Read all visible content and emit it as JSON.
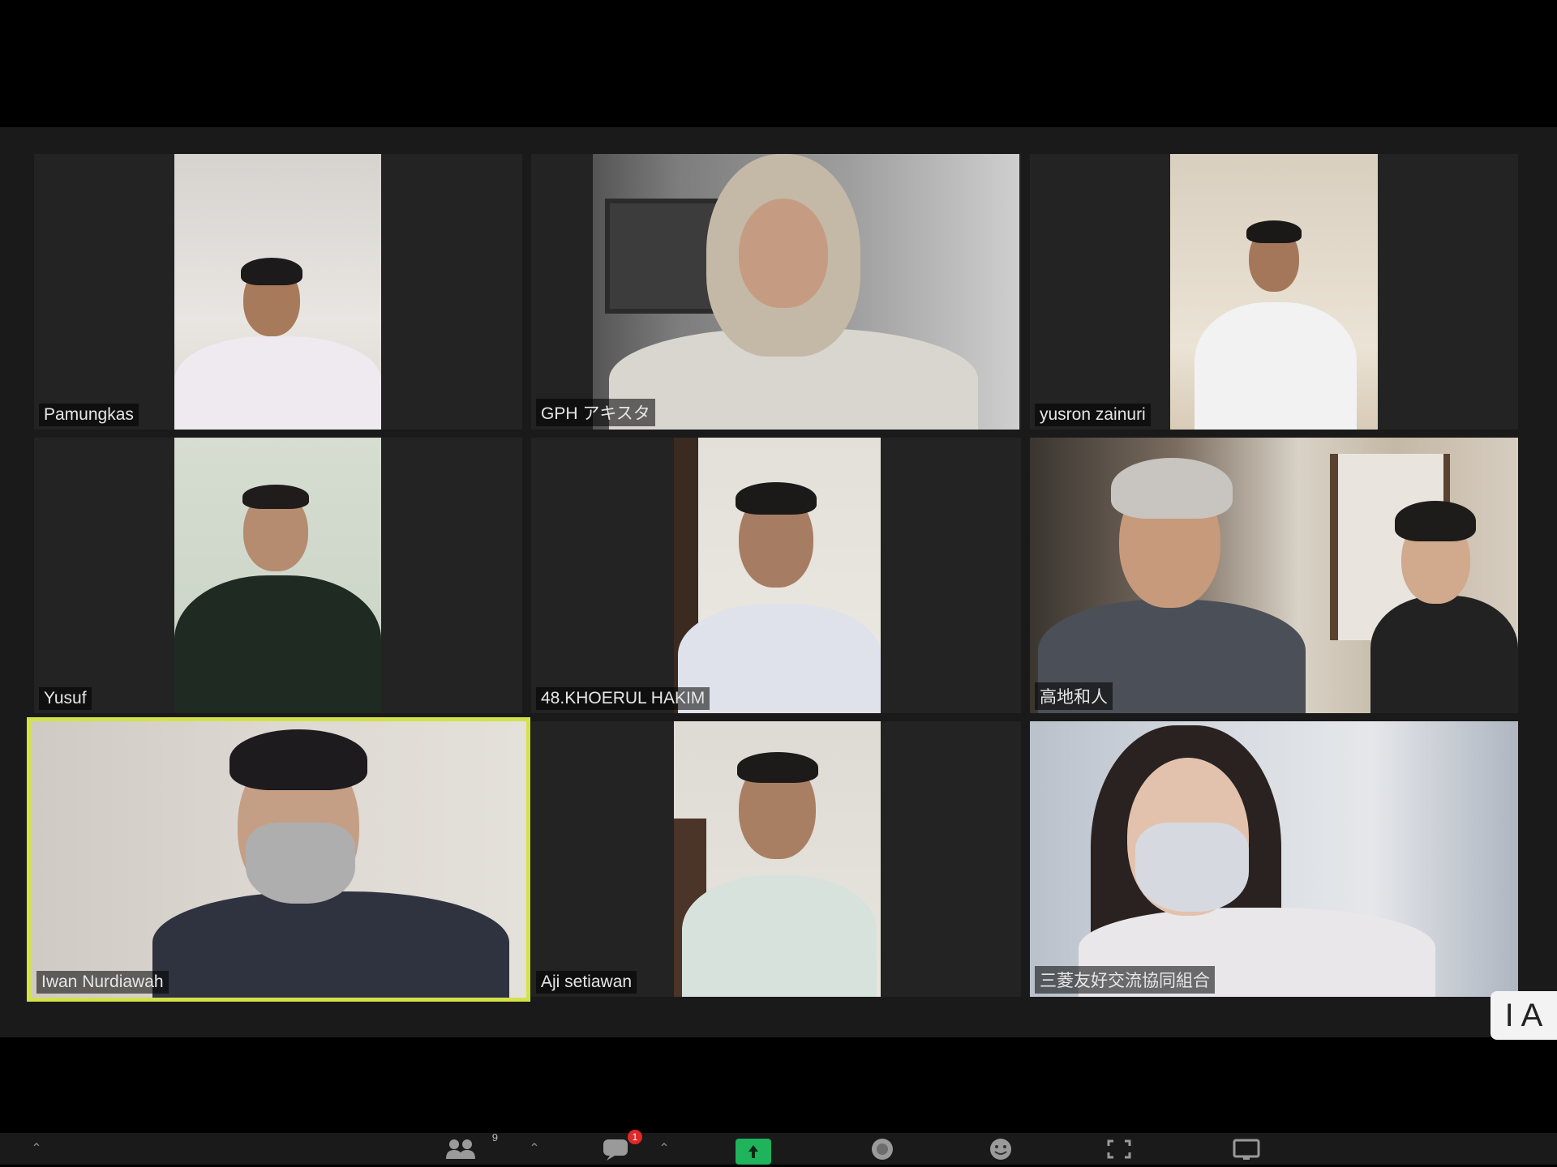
{
  "participants": [
    {
      "name": "Pamungkas"
    },
    {
      "name": "GPH アキスタ"
    },
    {
      "name": "yusron zainuri"
    },
    {
      "name": "Yusuf"
    },
    {
      "name": "48.KHOERUL HAKIM"
    },
    {
      "name": "高地和人"
    },
    {
      "name": "Iwan Nurdiawah"
    },
    {
      "name": "Aji setiawan"
    },
    {
      "name": "三菱友好交流協同組合"
    }
  ],
  "toolbar": {
    "participants_count": "9",
    "chat_badge": "1",
    "corner_label": "I A"
  },
  "colors": {
    "active_speaker_border": "#d4e24a",
    "share_green": "#1fb35b",
    "badge_red": "#e02828"
  },
  "icons": [
    "participants-icon",
    "chat-icon",
    "share-screen-icon",
    "record-icon",
    "reactions-icon",
    "fullscreen-icon",
    "view-icon"
  ]
}
